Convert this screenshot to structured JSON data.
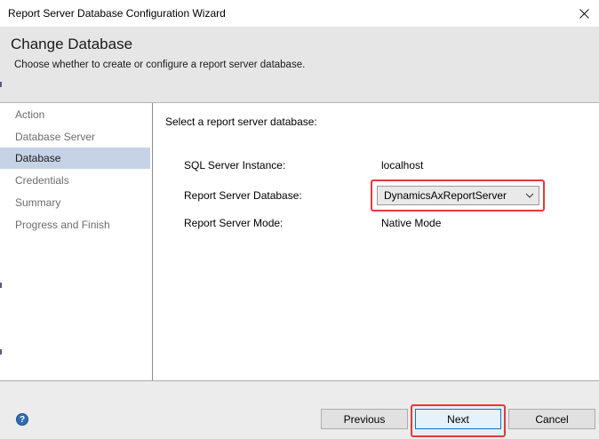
{
  "window": {
    "title": "Report Server Database Configuration Wizard"
  },
  "banner": {
    "title": "Change Database",
    "subtitle": "Choose whether to create or configure a report server database."
  },
  "nav": {
    "items": [
      {
        "label": "Action"
      },
      {
        "label": "Database Server"
      },
      {
        "label": "Database"
      },
      {
        "label": "Credentials"
      },
      {
        "label": "Summary"
      },
      {
        "label": "Progress and Finish"
      }
    ],
    "active_index": 2
  },
  "content": {
    "prompt": "Select a report server database:",
    "sql_instance": {
      "label": "SQL Server Instance:",
      "value": "localhost"
    },
    "report_db": {
      "label": "Report Server Database:",
      "selected": "DynamicsAxReportServer"
    },
    "mode": {
      "label": "Report Server Mode:",
      "value": "Native Mode"
    }
  },
  "footer": {
    "help_glyph": "?",
    "previous_label": "Previous",
    "next_label": "Next",
    "cancel_label": "Cancel"
  },
  "colors": {
    "highlight": "#e03b3b",
    "active_nav": "#c6d3e6",
    "help_icon": "#2f6db5"
  }
}
